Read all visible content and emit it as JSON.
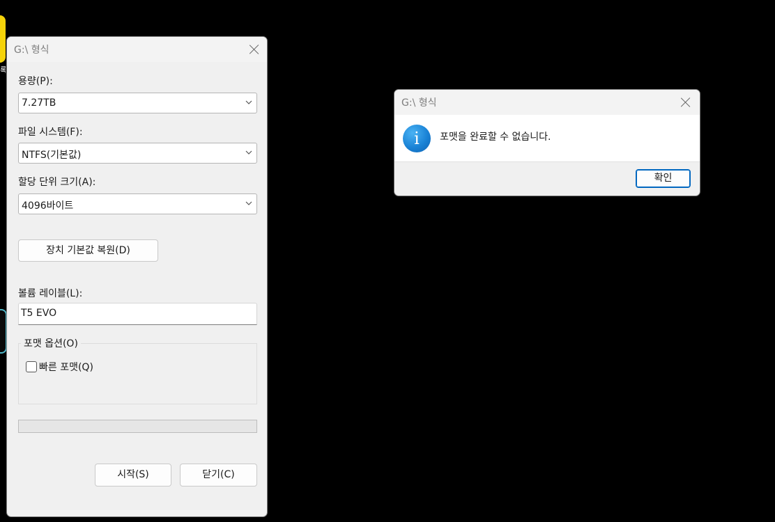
{
  "format_dialog": {
    "title": "G:\\ 형식",
    "capacity_label": "용량(P):",
    "capacity_value": "7.27TB",
    "filesystem_label": "파일 시스템(F):",
    "filesystem_value": "NTFS(기본값)",
    "allocation_label": "할당 단위 크기(A):",
    "allocation_value": "4096바이트",
    "restore_defaults_label": "장치 기본값 복원(D)",
    "volume_label_label": "볼륨 레이블(L):",
    "volume_label_value": "T5 EVO",
    "format_options_label": "포맷 옵션(O)",
    "quick_format_label": "빠른 포맷(Q)",
    "quick_format_checked": false,
    "progress": 0,
    "start_label": "시작(S)",
    "close_label": "닫기(C)"
  },
  "message_box": {
    "title": "G:\\ 형식",
    "icon": "info-icon",
    "message": "포맷을 완료할 수 없습니다.",
    "ok_label": "확인"
  },
  "colors": {
    "dialog_bg": "#f0f0f0",
    "desktop_bg": "#000000",
    "accent": "#0067c0",
    "info_blue": "#1a83d6"
  }
}
